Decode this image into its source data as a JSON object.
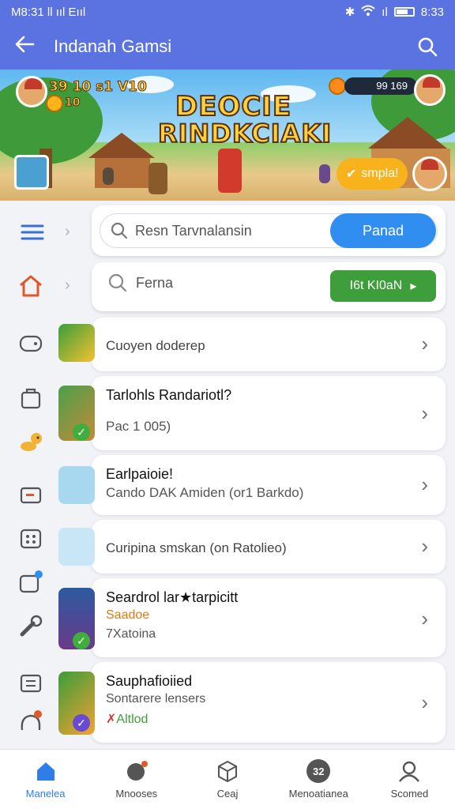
{
  "status_bar": {
    "left": "M8:31 ll ııl Eııl",
    "time": "8:33"
  },
  "app_bar": {
    "title": "Indanah Gamsi",
    "back_icon": "arrow-left-icon",
    "search_icon": "search-icon"
  },
  "banner": {
    "headline_line1": "DEOCIE",
    "headline_line2": "RINDKCIAKI",
    "stat_text": "39 10 s1 V10",
    "coin_count": "10",
    "score": "99 169",
    "cta_label": "smpla!"
  },
  "search_card": {
    "placeholder": "Resn Tarvnalansin",
    "button_label": "Panad"
  },
  "filter_card": {
    "label": "Ferna",
    "button_label": "I6t KI0aN"
  },
  "games": [
    {
      "title": "Cuoyen doderep"
    },
    {
      "title": "Tarlohls Randariotl?",
      "subtitle": "Pac 1 005)"
    },
    {
      "title": "Earlpaioie!",
      "subtitle": "Cando DAK Amiden (or1 Barkdo)"
    },
    {
      "title": "Curipina smskan (on Ratolieo)"
    },
    {
      "title": "Seardrol lar★tarpicitt",
      "tag": "Saadoe",
      "subtitle": "7Xatoina",
      "tag_color": "#e07a10"
    },
    {
      "title": "Sauphafioiied",
      "subtitle": "Sontarere lensers",
      "tag": "Altlod",
      "tag_color": "#3f9e3c"
    }
  ],
  "bottom_nav": [
    {
      "label": "Manelea",
      "icon": "home-icon",
      "active": true
    },
    {
      "label": "Mnooses",
      "icon": "gamepad-icon"
    },
    {
      "label": "Ceaj",
      "icon": "cube-icon"
    },
    {
      "label": "Menoatianea",
      "icon": "avatar-icon",
      "badge": "32"
    },
    {
      "label": "Scomed",
      "icon": "profile-icon"
    }
  ],
  "colors": {
    "primary": "#5b73e0",
    "accent_blue": "#2f8ef0",
    "accent_green": "#3f9e3c",
    "accent_orange": "#e07a10"
  }
}
